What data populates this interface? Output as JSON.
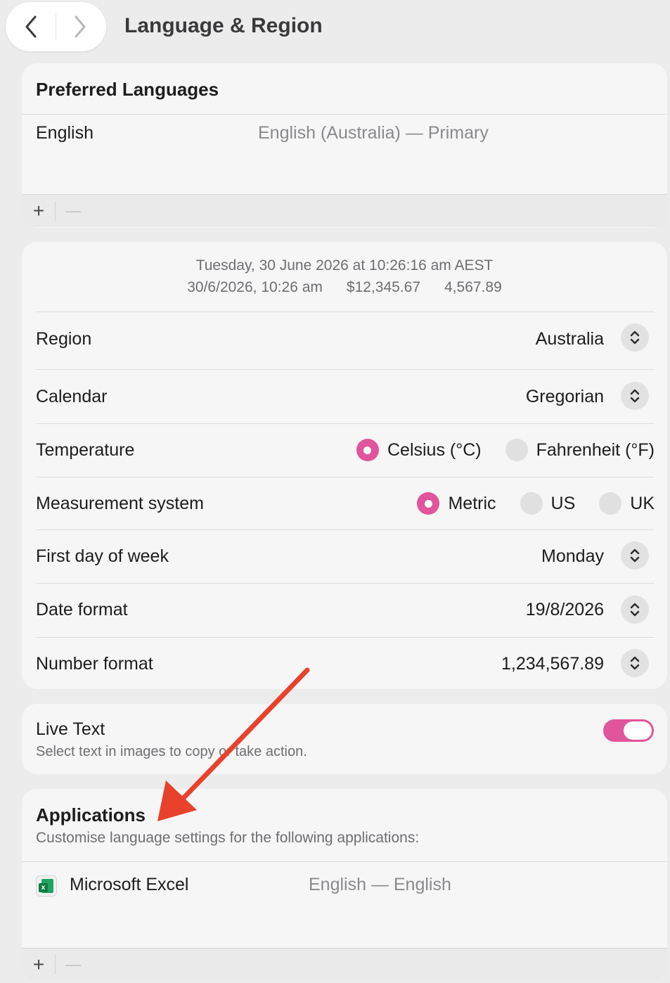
{
  "window": {
    "title": "Language & Region"
  },
  "nav": {
    "back_icon": "chevron-left-icon",
    "forward_icon": "chevron-right-icon"
  },
  "preferred_languages": {
    "heading": "Preferred Languages",
    "items": [
      {
        "name": "English",
        "detail": "English (Australia) — Primary"
      }
    ],
    "add_label": "+",
    "remove_label": "—"
  },
  "format_preview": {
    "line1": "Tuesday, 30 June 2026 at 10:26:16 am AEST",
    "date_short": "30/6/2026, 10:26 am",
    "currency": "$12,345.67",
    "number": "4,567.89"
  },
  "settings": {
    "region": {
      "label": "Region",
      "value": "Australia"
    },
    "calendar": {
      "label": "Calendar",
      "value": "Gregorian"
    },
    "temperature": {
      "label": "Temperature",
      "options": [
        "Celsius (°C)",
        "Fahrenheit (°F)"
      ],
      "selected": "Celsius (°C)"
    },
    "measurement": {
      "label": "Measurement system",
      "options": [
        "Metric",
        "US",
        "UK"
      ],
      "selected": "Metric"
    },
    "first_day": {
      "label": "First day of week",
      "value": "Monday"
    },
    "date_format": {
      "label": "Date format",
      "value": "19/8/2026"
    },
    "number_format": {
      "label": "Number format",
      "value": "1,234,567.89"
    }
  },
  "live_text": {
    "title": "Live Text",
    "subtitle": "Select text in images to copy or take action.",
    "enabled": true
  },
  "applications": {
    "heading": "Applications",
    "subtitle": "Customise language settings for the following applications:",
    "items": [
      {
        "name": "Microsoft Excel",
        "detail": "English — English",
        "icon": "excel-icon"
      }
    ],
    "add_label": "+",
    "remove_label": "—"
  },
  "colors": {
    "accent": "#e0559b",
    "annotation_arrow": "#e8412c"
  }
}
